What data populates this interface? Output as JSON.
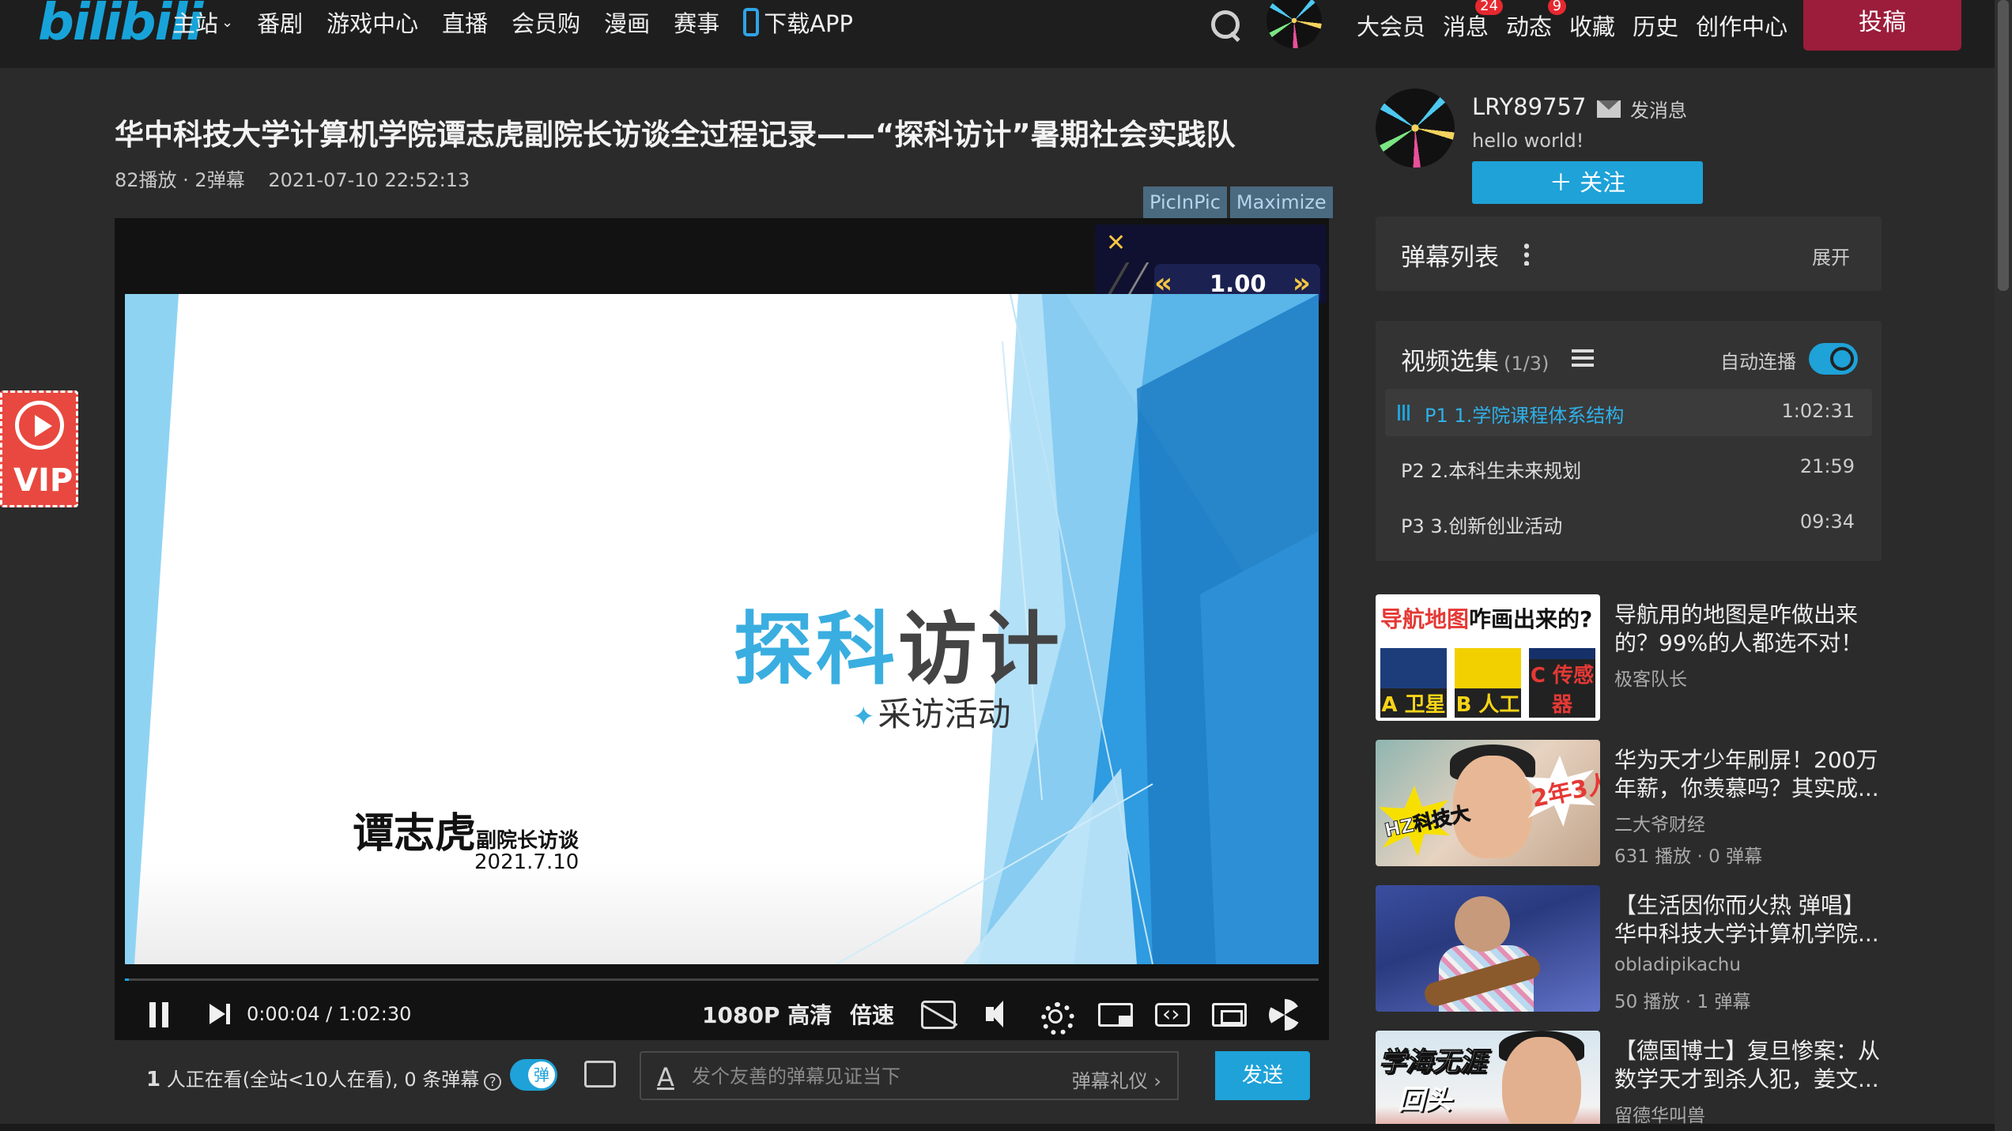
{
  "header": {
    "logo": "bilibili",
    "nav": [
      {
        "label": "主站",
        "chevron": true
      },
      {
        "label": "番剧"
      },
      {
        "label": "游戏中心"
      },
      {
        "label": "直播"
      },
      {
        "label": "会员购"
      },
      {
        "label": "漫画"
      },
      {
        "label": "赛事"
      },
      {
        "label": "下载APP",
        "icon": "phone-icon"
      }
    ],
    "right": [
      {
        "label": "大会员"
      },
      {
        "label": "消息",
        "badge": "24"
      },
      {
        "label": "动态",
        "badge": "9"
      },
      {
        "label": "收藏"
      },
      {
        "label": "历史"
      },
      {
        "label": "创作中心"
      }
    ],
    "upload_label": "投稿"
  },
  "vip_float": {
    "label": "VIP"
  },
  "video": {
    "title": "华中科技大学计算机学院谭志虎副院长访谈全过程记录——“探科访计”暑期社会实践队",
    "plays": "82播放 · 2弹幕",
    "date": "2021-07-10 22:52:13",
    "pip_label": "PicInPic",
    "maximize_label": "Maximize"
  },
  "speed_panel": {
    "close": "✕",
    "left": "«",
    "value": "1.00",
    "right": "»"
  },
  "slide": {
    "title_blue": "探科",
    "title_dark": "访计",
    "subtitle": "采访活动",
    "name": "谭志虎",
    "role": "副院长访谈",
    "date": "2021.7.10"
  },
  "player": {
    "progress": 0.001,
    "time_current": "0:00:04",
    "time_sep": "/",
    "time_total": "1:02:30",
    "quality": "1080P 高清",
    "speed_label": "倍速"
  },
  "send_bar": {
    "viewers_count": "1",
    "viewers_text": " 人正在看(全站<10人在看), 0 条弹幕",
    "toggle_label": "弹",
    "placeholder": "发个友善的弹幕见证当下",
    "etiquette": "弹幕礼仪 ›",
    "send_label": "发送"
  },
  "uploader": {
    "name": "LRY89757",
    "message_label": "发消息",
    "sign": "hello world!",
    "follow_label": "＋ 关注"
  },
  "danmu_panel": {
    "title": "弹幕列表",
    "expand": "展开"
  },
  "episodes": {
    "title": "视频选集",
    "count": "(1/3)",
    "autoplay_label": "自动连播",
    "autoplay_on": true,
    "items": [
      {
        "label": "P1   1.学院课程体系结构",
        "duration": "1:02:31",
        "active": true
      },
      {
        "label": "P2   2.本科生未来规划",
        "duration": "21:59",
        "active": false
      },
      {
        "label": "P3   3.创新创业活动",
        "duration": "09:34",
        "active": false
      }
    ]
  },
  "recommendations": [
    {
      "title": "导航用的地图是咋做出来的？99%的人都选不对！",
      "author": "极客队长",
      "stats": "",
      "thumb_text": {
        "head_red": "导航地图",
        "head_dark": "咋画出来的?",
        "cells": [
          "A 卫星",
          "B 人工",
          "C 传感器"
        ]
      }
    },
    {
      "title": "华为天才少年刷屏！200万年薪，你羡慕吗？其实成...",
      "author": "二大爷财经",
      "stats": "631 播放 · 0 弹幕",
      "thumb_text": {
        "left": "HZ科技大",
        "right": "2年3人"
      }
    },
    {
      "title": "【生活因你而火热 弹唱】华中科技大学计算机学院...",
      "author": "obladipikachu",
      "stats": "50 播放 · 1 弹幕",
      "thumb_text": {}
    },
    {
      "title": "【德国博士】复旦惨案：从数学天才到杀人犯，姜文...",
      "author": "留德华叫兽",
      "stats": "",
      "thumb_text": {
        "line1": "学海无涯",
        "line2": "回头"
      }
    }
  ]
}
